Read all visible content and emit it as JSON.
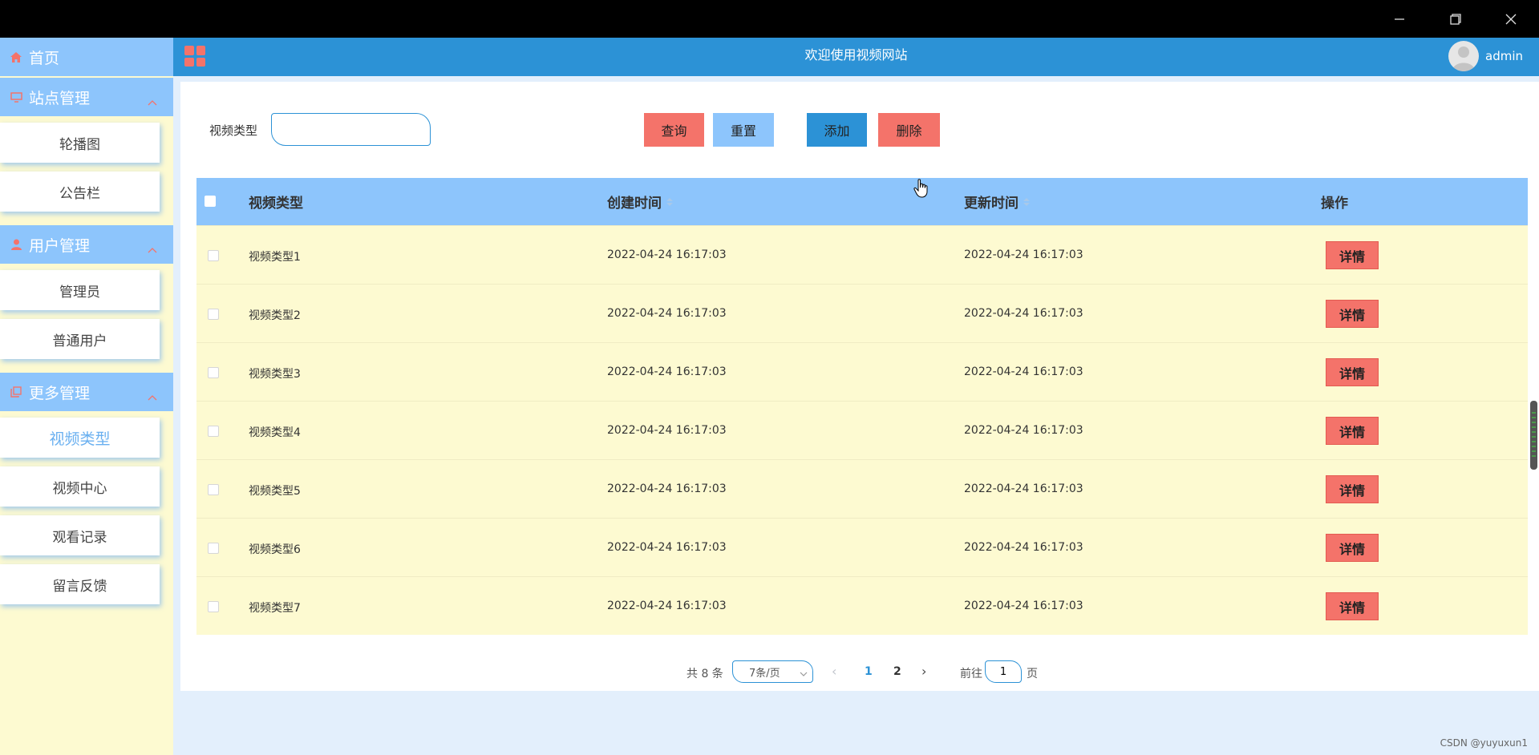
{
  "window": {
    "minimize_icon": "minimize-icon",
    "restore_icon": "restore-icon",
    "close_icon": "close-icon"
  },
  "header": {
    "title": "欢迎使用视频网站",
    "username": "admin",
    "menu_icon": "grid-menu-icon"
  },
  "sidebar": {
    "home": {
      "label": "首页",
      "icon": "home-icon"
    },
    "groups": [
      {
        "label": "站点管理",
        "icon": "monitor-icon",
        "items": [
          "轮播图",
          "公告栏"
        ]
      },
      {
        "label": "用户管理",
        "icon": "user-icon",
        "items": [
          "管理员",
          "普通用户"
        ]
      },
      {
        "label": "更多管理",
        "icon": "copy-icon",
        "items": [
          "视频类型",
          "视频中心",
          "观看记录",
          "留言反馈"
        ]
      }
    ],
    "active_item": "视频类型"
  },
  "search": {
    "label": "视频类型",
    "value": "",
    "placeholder": ""
  },
  "buttons": {
    "query": "查询",
    "reset": "重置",
    "add": "添加",
    "delete": "删除"
  },
  "table": {
    "columns": [
      "视频类型",
      "创建时间",
      "更新时间",
      "操作"
    ],
    "rows": [
      {
        "type": "视频类型1",
        "created": "2022-04-24 16:17:03",
        "updated": "2022-04-24 16:17:03",
        "action": "详情"
      },
      {
        "type": "视频类型2",
        "created": "2022-04-24 16:17:03",
        "updated": "2022-04-24 16:17:03",
        "action": "详情"
      },
      {
        "type": "视频类型3",
        "created": "2022-04-24 16:17:03",
        "updated": "2022-04-24 16:17:03",
        "action": "详情"
      },
      {
        "type": "视频类型4",
        "created": "2022-04-24 16:17:03",
        "updated": "2022-04-24 16:17:03",
        "action": "详情"
      },
      {
        "type": "视频类型5",
        "created": "2022-04-24 16:17:03",
        "updated": "2022-04-24 16:17:03",
        "action": "详情"
      },
      {
        "type": "视频类型6",
        "created": "2022-04-24 16:17:03",
        "updated": "2022-04-24 16:17:03",
        "action": "详情"
      },
      {
        "type": "视频类型7",
        "created": "2022-04-24 16:17:03",
        "updated": "2022-04-24 16:17:03",
        "action": "详情"
      }
    ]
  },
  "pagination": {
    "total": "共 8 条",
    "page_size": "7条/页",
    "pages": [
      "1",
      "2"
    ],
    "current_page": "1",
    "goto_prefix": "前往",
    "goto_value": "1",
    "goto_suffix": "页"
  },
  "colors": {
    "primary": "#2c92d6",
    "light_blue": "#8dc5fc",
    "salmon": "#f4736a",
    "cream": "#fdfad1"
  },
  "watermark": "CSDN @yuyuxun1"
}
